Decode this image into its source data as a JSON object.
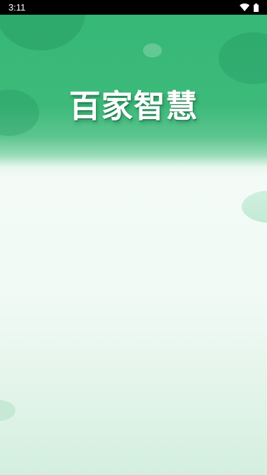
{
  "status_bar": {
    "time": "3:11",
    "icons": [
      "wifi-icon",
      "battery-icon"
    ]
  },
  "splash": {
    "title": "百家智慧"
  },
  "colors": {
    "brand_green": "#35b776",
    "status_bar_bg": "#000000",
    "background_bottom": "#d3efdf"
  }
}
